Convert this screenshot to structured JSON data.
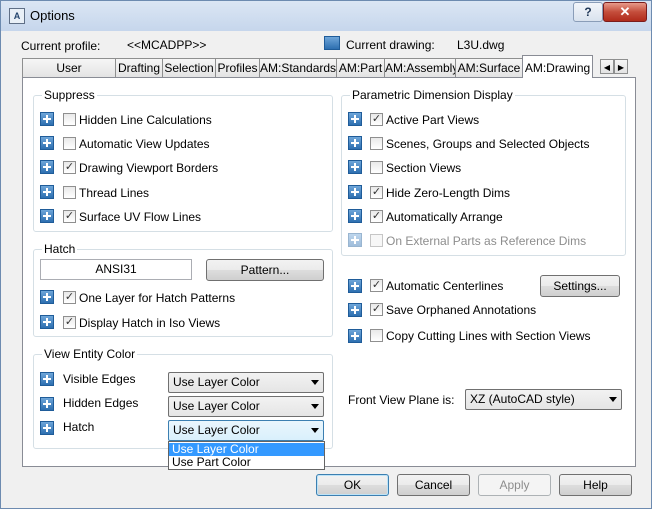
{
  "window": {
    "title": "Options",
    "app_icon_text": "A",
    "help_label": "?",
    "close_label": "✕"
  },
  "header": {
    "current_profile_label": "Current profile:",
    "current_profile_value": "<<MCADPP>>",
    "current_drawing_label": "Current drawing:",
    "current_drawing_value": "L3U.dwg"
  },
  "tabs": [
    {
      "label": "User Preferences"
    },
    {
      "label": "Drafting"
    },
    {
      "label": "Selection"
    },
    {
      "label": "Profiles"
    },
    {
      "label": "AM:Standards"
    },
    {
      "label": "AM:Part"
    },
    {
      "label": "AM:Assembly"
    },
    {
      "label": "AM:Surface"
    },
    {
      "label": "AM:Drawing",
      "active": true
    }
  ],
  "suppress": {
    "title": "Suppress",
    "items": [
      {
        "label": "Hidden Line Calculations",
        "checked": false
      },
      {
        "label": "Automatic View Updates",
        "checked": false
      },
      {
        "label": "Drawing Viewport Borders",
        "checked": true
      },
      {
        "label": "Thread Lines",
        "checked": false
      },
      {
        "label": "Surface UV Flow Lines",
        "checked": true
      }
    ]
  },
  "hatch": {
    "title": "Hatch",
    "pattern_value": "ANSI31",
    "pattern_button": "Pattern...",
    "items": [
      {
        "label": "One Layer for Hatch Patterns",
        "checked": true
      },
      {
        "label": "Display Hatch in Iso Views",
        "checked": true
      }
    ]
  },
  "view_entity_color": {
    "title": "View Entity Color",
    "rows": [
      {
        "label": "Visible Edges",
        "value": "Use Layer Color"
      },
      {
        "label": "Hidden Edges",
        "value": "Use Layer Color"
      },
      {
        "label": "Hatch",
        "value": "Use Layer Color"
      }
    ],
    "dropdown_options": [
      "Use Layer Color",
      "Use Part Color"
    ],
    "dropdown_selected": "Use Layer Color"
  },
  "parametric": {
    "title": "Parametric Dimension Display",
    "items": [
      {
        "label": "Active Part Views",
        "checked": true,
        "enabled": true
      },
      {
        "label": "Scenes, Groups and Selected Objects",
        "checked": false,
        "enabled": true
      },
      {
        "label": "Section Views",
        "checked": false,
        "enabled": true
      },
      {
        "label": "Hide Zero-Length Dims",
        "checked": true,
        "enabled": true
      },
      {
        "label": "Automatically Arrange",
        "checked": true,
        "enabled": true
      },
      {
        "label": "On External Parts as Reference Dims",
        "checked": false,
        "enabled": false
      }
    ]
  },
  "misc": {
    "items": [
      {
        "label": "Automatic Centerlines",
        "checked": true
      },
      {
        "label": "Save Orphaned Annotations",
        "checked": true
      },
      {
        "label": "Copy Cutting Lines with Section Views",
        "checked": false
      }
    ],
    "settings_button": "Settings...",
    "front_view_label": "Front View Plane is:",
    "front_view_value": "XZ (AutoCAD style)"
  },
  "footer": {
    "ok": "OK",
    "cancel": "Cancel",
    "apply": "Apply",
    "help": "Help"
  },
  "colors": {
    "accent": "#3399ff",
    "title_bar": "#c6d6ec",
    "close_button": "#c44d3b"
  }
}
